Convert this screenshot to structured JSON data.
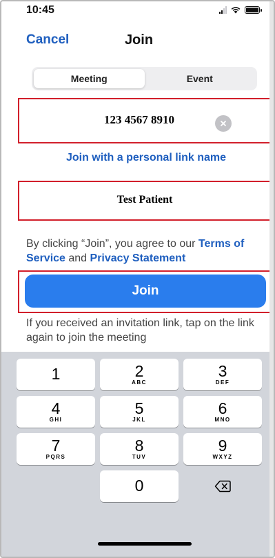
{
  "status_bar": {
    "time": "10:45"
  },
  "nav": {
    "cancel_label": "Cancel",
    "title": "Join"
  },
  "segments": [
    {
      "label": "Meeting",
      "selected": true
    },
    {
      "label": "Event",
      "selected": false
    }
  ],
  "meeting_id": {
    "value": "123 4567 8910",
    "clear_icon": "clear-icon"
  },
  "personal_link_label": "Join with a personal link name",
  "name_field": {
    "value": "Test Patient"
  },
  "terms": {
    "prefix": "By clicking “Join”, you agree to our ",
    "terms_link": "Terms of Service",
    "middle": " and ",
    "privacy_link": "Privacy Statement"
  },
  "join_button_label": "Join",
  "invite_text": "If you received an invitation link, tap on the link again to join the meeting",
  "keypad": {
    "keys": [
      {
        "digit": "1",
        "letters": ""
      },
      {
        "digit": "2",
        "letters": "ABC"
      },
      {
        "digit": "3",
        "letters": "DEF"
      },
      {
        "digit": "4",
        "letters": "GHI"
      },
      {
        "digit": "5",
        "letters": "JKL"
      },
      {
        "digit": "6",
        "letters": "MNO"
      },
      {
        "digit": "7",
        "letters": "PQRS"
      },
      {
        "digit": "8",
        "letters": "TUV"
      },
      {
        "digit": "9",
        "letters": "WXYZ"
      },
      {
        "digit": "0",
        "letters": ""
      }
    ],
    "delete_icon": "backspace-icon"
  },
  "colors": {
    "accent": "#2a7ded",
    "link": "#1f5fbf",
    "highlight_border": "#d21f2b",
    "keypad_background": "#d2d5db"
  }
}
